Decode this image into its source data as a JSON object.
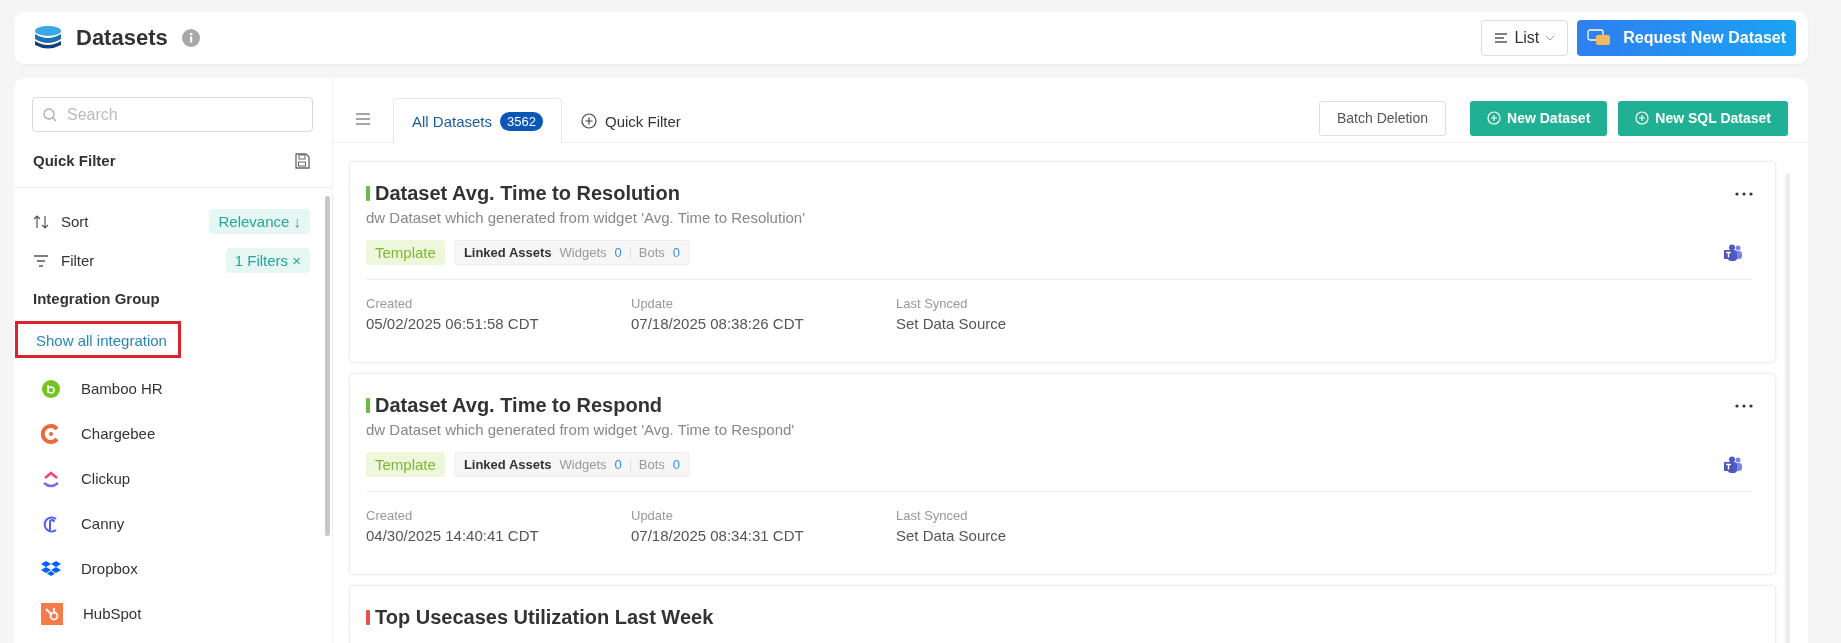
{
  "header": {
    "title": "Datasets",
    "view_select": {
      "value": "List"
    },
    "request_button": "Request New Dataset"
  },
  "sidebar": {
    "search": {
      "placeholder": "Search"
    },
    "quick_filter_title": "Quick Filter",
    "sort": {
      "label": "Sort",
      "value": "Relevance ↓"
    },
    "filter": {
      "label": "Filter",
      "value": "1 Filters ×"
    },
    "integration_group_title": "Integration Group",
    "show_all_link": {
      "label": "Show all integration",
      "highlighted": true
    },
    "integrations": [
      {
        "name": "Bamboo HR",
        "kind": "bamboo"
      },
      {
        "name": "Chargebee",
        "kind": "chargebee"
      },
      {
        "name": "Clickup",
        "kind": "clickup"
      },
      {
        "name": "Canny",
        "kind": "canny"
      },
      {
        "name": "Dropbox",
        "kind": "dropbox"
      },
      {
        "name": "HubSpot",
        "kind": "hubspot"
      }
    ]
  },
  "tabs": [
    {
      "label": "All Datasets",
      "count": "3562",
      "selected": true
    },
    {
      "label": "Quick Filter",
      "selected": false
    }
  ],
  "toolbar": {
    "batch_button": "Batch Deletion",
    "new_button": "New Dataset",
    "new_sql_button": "New SQL Dataset"
  },
  "datasets": [
    {
      "title": "Dataset Avg. Time to Resolution",
      "color": "#6dbd45",
      "description": "dw Dataset which generated from widget 'Avg. Time to Resolution'",
      "tag": "Template",
      "linked_label": "Linked Assets",
      "widgets_label": "Widgets",
      "widgets": "0",
      "bots_label": "Bots",
      "bots": "0",
      "created_label": "Created",
      "created": "05/02/2025 06:51:58 CDT",
      "update_label": "Update",
      "update": "07/18/2025 08:38:26 CDT",
      "synced_label": "Last Synced",
      "synced": "Set Data Source"
    },
    {
      "title": "Dataset Avg. Time to Respond",
      "color": "#6dbd45",
      "description": "dw Dataset which generated from widget 'Avg. Time to Respond'",
      "tag": "Template",
      "linked_label": "Linked Assets",
      "widgets_label": "Widgets",
      "widgets": "0",
      "bots_label": "Bots",
      "bots": "0",
      "created_label": "Created",
      "created": "04/30/2025 14:40:41 CDT",
      "update_label": "Update",
      "update": "07/18/2025 08:34:31 CDT",
      "synced_label": "Last Synced",
      "synced": "Set Data Source"
    },
    {
      "title": "Top Usecases Utilization Last Week",
      "color": "#e5534b"
    }
  ]
}
